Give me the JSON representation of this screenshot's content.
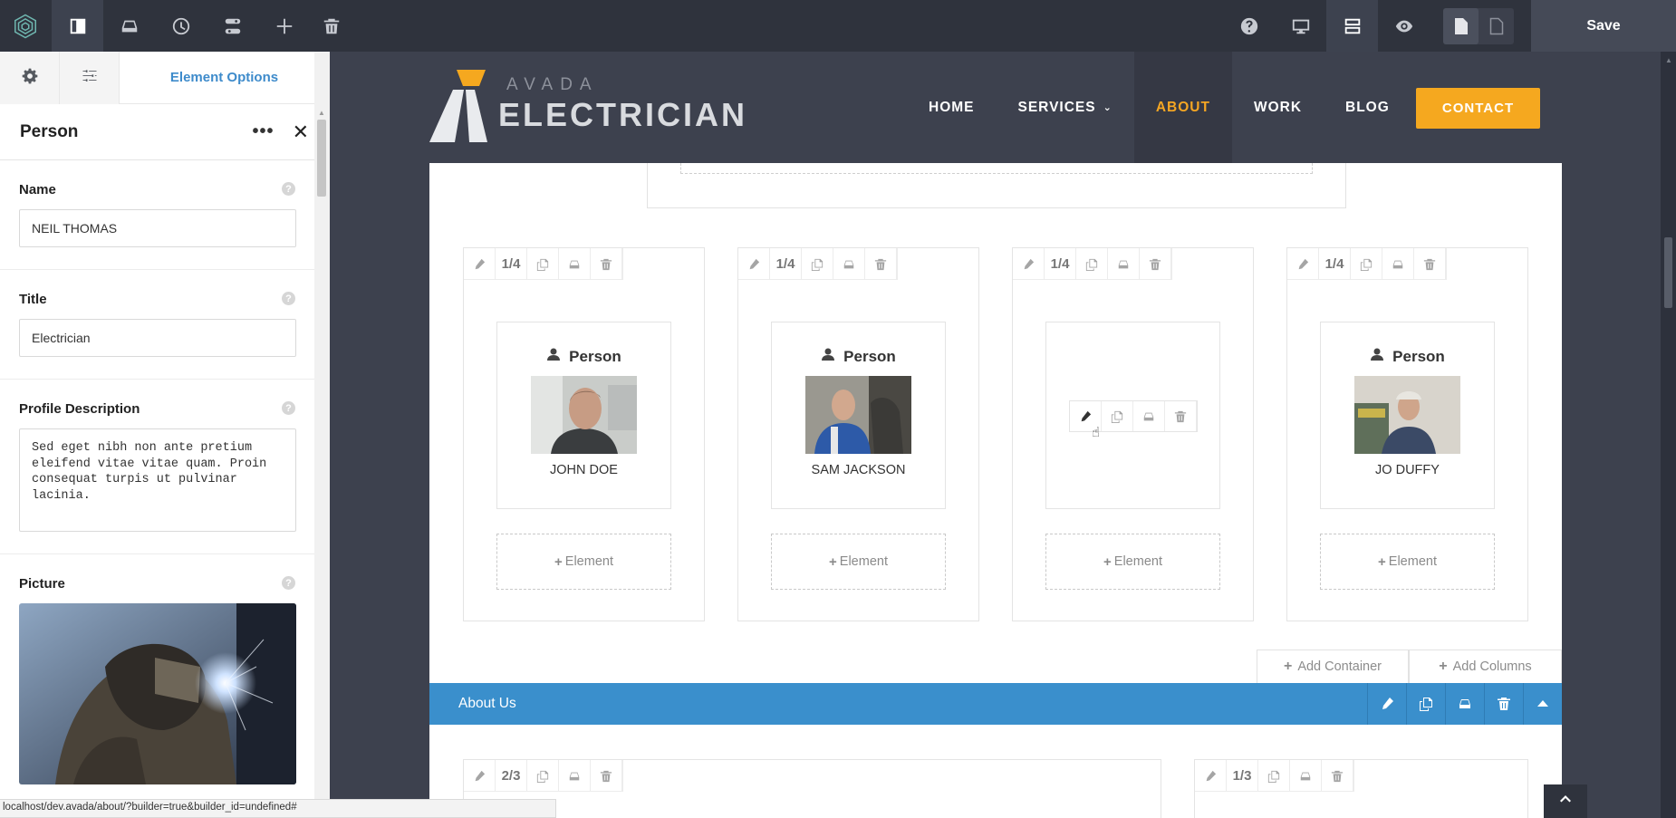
{
  "toolbar": {
    "save_label": "Save",
    "left_icons": [
      "avada-logo-icon",
      "sidebar-toggle-icon",
      "library-icon",
      "history-icon",
      "settings-toggle-icon",
      "add-icon",
      "trash-icon"
    ],
    "right_icons": [
      "help-icon",
      "desktop-icon",
      "layout-icon",
      "preview-icon",
      "page-icon",
      "page-outline-icon"
    ]
  },
  "sidebar": {
    "tab_label": "Element Options",
    "element_title": "Person",
    "fields": {
      "name_label": "Name",
      "name_value": "NEIL THOMAS",
      "title_label": "Title",
      "title_value": "Electrician",
      "description_label": "Profile Description",
      "description_value": "Sed eget nibh non ante pretium\neleifend vitae vitae quam. Proin\nconsequat turpis ut pulvinar\nlacinia.",
      "picture_label": "Picture"
    }
  },
  "site": {
    "logo_sub": "AVADA",
    "logo_main": "ELECTRICIAN",
    "nav": [
      {
        "label": "HOME"
      },
      {
        "label": "SERVICES"
      },
      {
        "label": "ABOUT"
      },
      {
        "label": "WORK"
      },
      {
        "label": "BLOG"
      }
    ],
    "contact_label": "CONTACT"
  },
  "builder": {
    "column_size": "1/4",
    "person_label": "Person",
    "add_element_label": "Element",
    "people": [
      {
        "name": "JOHN DOE"
      },
      {
        "name": "SAM JACKSON"
      },
      {
        "name": ""
      },
      {
        "name": "JO DUFFY"
      }
    ],
    "add_container_label": "Add Container",
    "add_columns_label": "Add Columns",
    "about_label": "About Us",
    "col2_size": "2/3",
    "col3_size": "1/3"
  },
  "status": {
    "url": "localhost/dev.avada/about/?builder=true&builder_id=undefined#"
  },
  "colors": {
    "toolbar_bg": "#2f333d",
    "accent_blue": "#3a8fcc",
    "accent_orange": "#f5a81f"
  }
}
